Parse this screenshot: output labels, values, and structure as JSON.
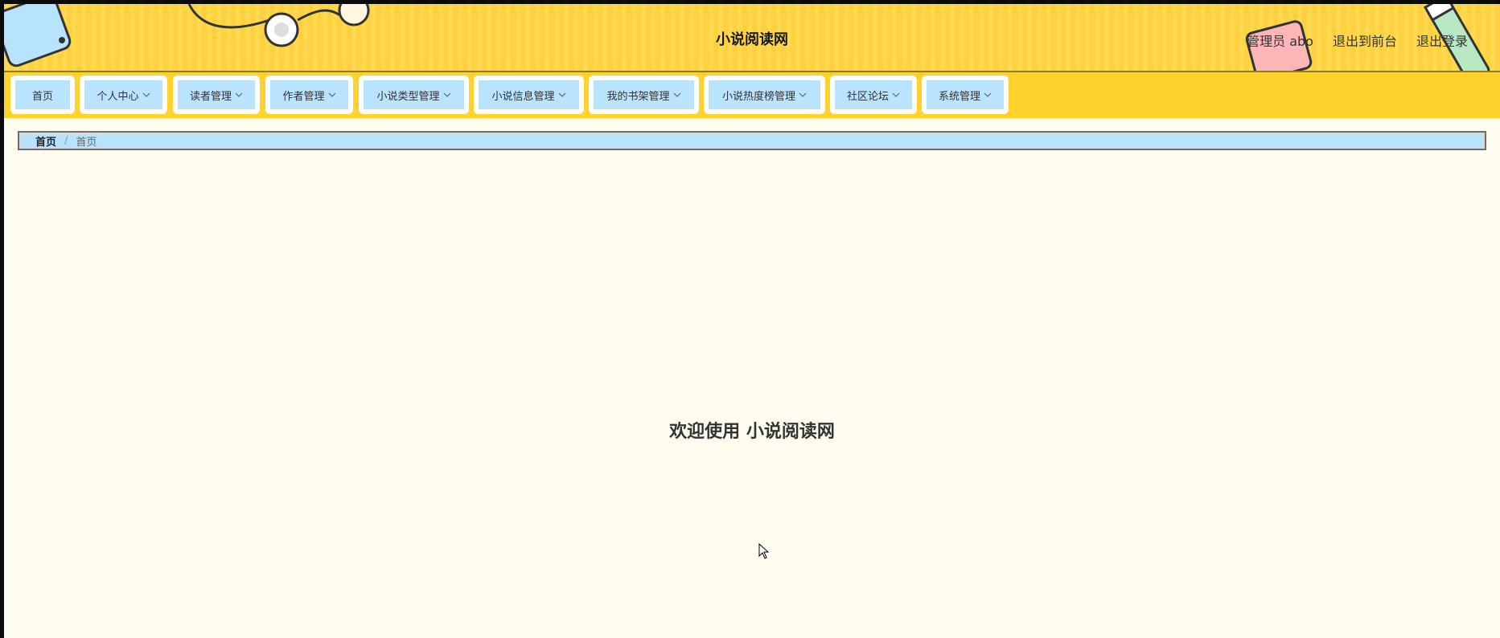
{
  "header": {
    "site_title": "小说阅读网",
    "user_label": "管理员 abo",
    "to_frontend": "退出到前台",
    "logout": "退出登录"
  },
  "nav": {
    "items": [
      {
        "label": "首页",
        "has_dropdown": false
      },
      {
        "label": "个人中心",
        "has_dropdown": true
      },
      {
        "label": "读者管理",
        "has_dropdown": true
      },
      {
        "label": "作者管理",
        "has_dropdown": true
      },
      {
        "label": "小说类型管理",
        "has_dropdown": true
      },
      {
        "label": "小说信息管理",
        "has_dropdown": true
      },
      {
        "label": "我的书架管理",
        "has_dropdown": true
      },
      {
        "label": "小说热度榜管理",
        "has_dropdown": true
      },
      {
        "label": "社区论坛",
        "has_dropdown": true
      },
      {
        "label": "系统管理",
        "has_dropdown": true
      }
    ]
  },
  "breadcrumb": {
    "home": "首页",
    "separator": "/",
    "current": "首页"
  },
  "main": {
    "welcome": "欢迎使用 小说阅读网"
  },
  "colors": {
    "header_bg": "#ffd94d",
    "nav_bg": "#ffd22e",
    "nav_item_bg": "#b9e3ff",
    "breadcrumb_bg": "#b7e3ff",
    "page_bg": "#fffdf0"
  }
}
